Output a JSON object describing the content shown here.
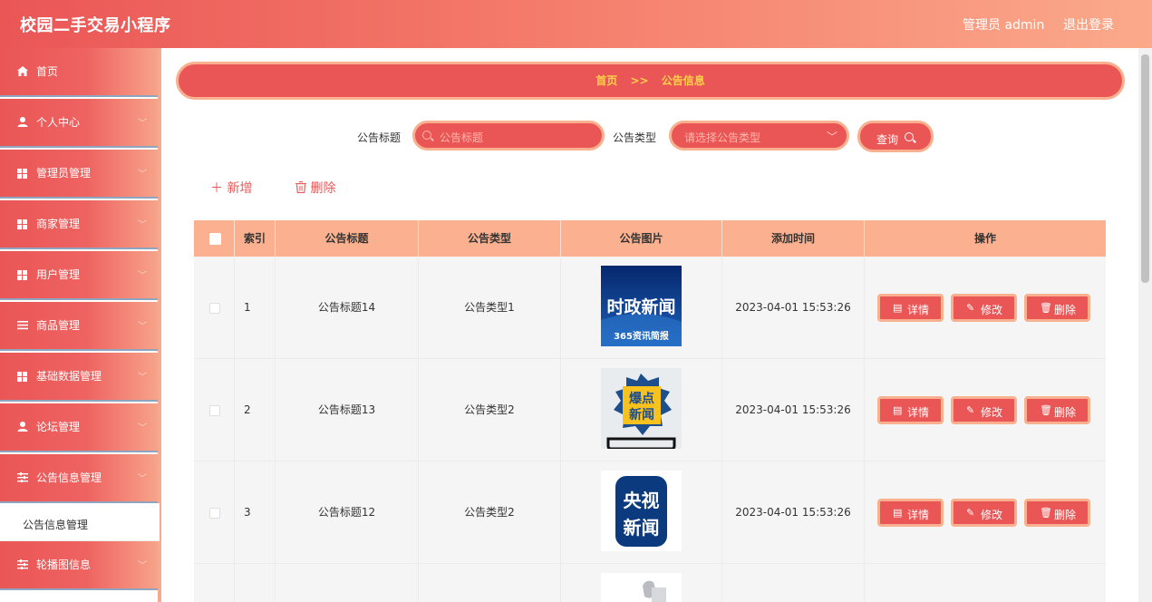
{
  "header": {
    "app_title": "校园二手交易小程序",
    "user": "管理员 admin",
    "logout": "退出登录"
  },
  "sidebar": {
    "items": [
      {
        "label": "首页",
        "icon": "home-icon"
      },
      {
        "label": "个人中心",
        "icon": "user-icon"
      },
      {
        "label": "管理员管理",
        "icon": "grid-icon"
      },
      {
        "label": "商家管理",
        "icon": "grid-icon"
      },
      {
        "label": "用户管理",
        "icon": "grid-icon"
      },
      {
        "label": "商品管理",
        "icon": "list-icon"
      },
      {
        "label": "基础数据管理",
        "icon": "grid-icon"
      },
      {
        "label": "论坛管理",
        "icon": "user-icon"
      },
      {
        "label": "公告信息管理",
        "icon": "sliders-icon"
      }
    ],
    "active_sub": "公告信息管理",
    "last_item": {
      "label": "轮播图信息",
      "icon": "sliders-icon"
    }
  },
  "breadcrumb": {
    "home": "首页",
    "sep": ">>",
    "current": "公告信息"
  },
  "search": {
    "title_label": "公告标题",
    "title_placeholder": "公告标题",
    "type_label": "公告类型",
    "type_placeholder": "请选择公告类型",
    "query_label": "查询"
  },
  "actions": {
    "add": "新增",
    "delete": "删除"
  },
  "table": {
    "headers": [
      "索引",
      "公告标题",
      "公告类型",
      "公告图片",
      "添加时间",
      "操作"
    ],
    "rows": [
      {
        "index": "1",
        "title": "公告标题14",
        "type": "公告类型1",
        "image_text": [
          "时政新闻",
          "365资讯简报"
        ],
        "time": "2023-04-01 15:53:26"
      },
      {
        "index": "2",
        "title": "公告标题13",
        "type": "公告类型2",
        "image_text": [
          "爆点",
          "新闻"
        ],
        "time": "2023-04-01 15:53:26"
      },
      {
        "index": "3",
        "title": "公告标题12",
        "type": "公告类型2",
        "image_text": [
          "央视",
          "新闻"
        ],
        "time": "2023-04-01 15:53:26"
      }
    ],
    "op_labels": {
      "detail": "详情",
      "edit": "修改",
      "delete": "删除"
    }
  },
  "colors": {
    "primary": "#ea5656",
    "accent_border": "#f9b08f",
    "header_row": "#fbb18f",
    "breadcrumb_text": "#ffd14a"
  }
}
